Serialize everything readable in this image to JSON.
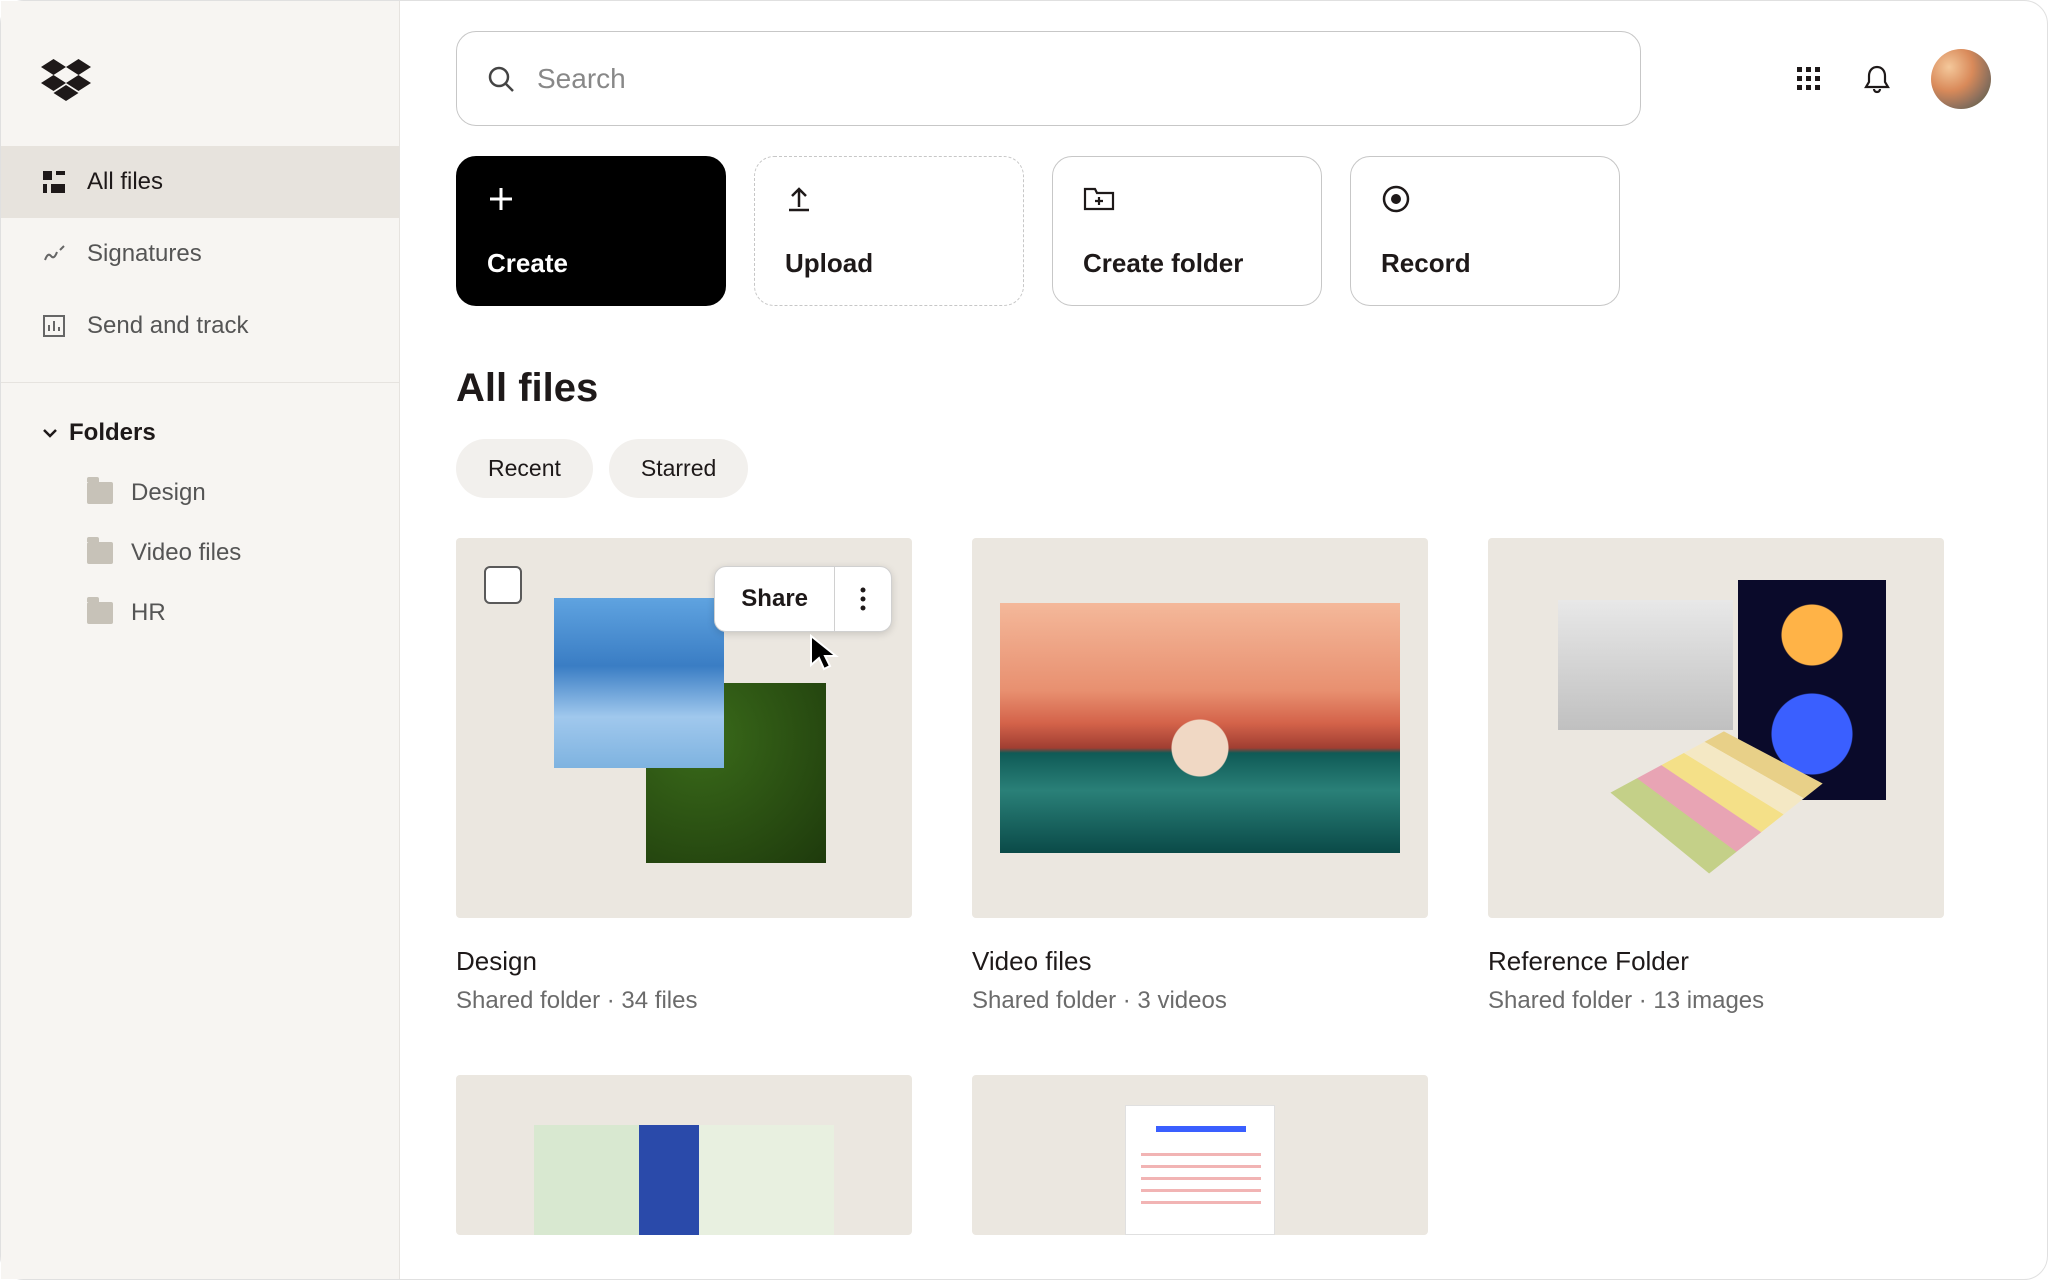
{
  "search": {
    "placeholder": "Search"
  },
  "sidebar": {
    "items": [
      {
        "label": "All files"
      },
      {
        "label": "Signatures"
      },
      {
        "label": "Send and track"
      }
    ],
    "folders_header": "Folders",
    "folders": [
      {
        "label": "Design"
      },
      {
        "label": "Video files"
      },
      {
        "label": "HR"
      }
    ]
  },
  "actions": {
    "create": "Create",
    "upload": "Upload",
    "create_folder": "Create folder",
    "record": "Record"
  },
  "page_title": "All files",
  "filters": {
    "recent": "Recent",
    "starred": "Starred"
  },
  "hover": {
    "share": "Share"
  },
  "cards": [
    {
      "title": "Design",
      "meta": "Shared folder · 34 files"
    },
    {
      "title": "Video files",
      "meta": "Shared folder · 3 videos"
    },
    {
      "title": "Reference Folder",
      "meta": "Shared folder · 13 images"
    }
  ]
}
